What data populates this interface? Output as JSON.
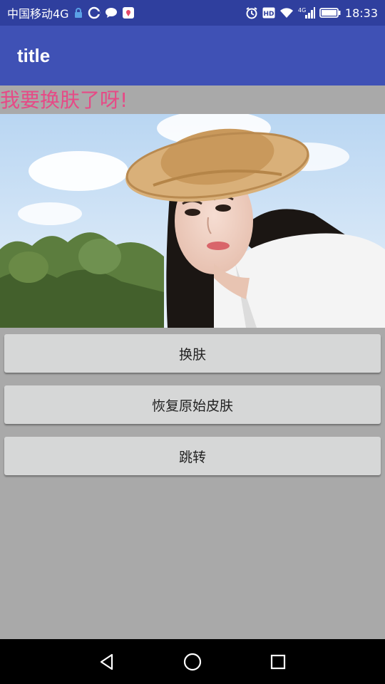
{
  "status_bar": {
    "carrier": "中国移动4G",
    "time": "18:33",
    "left_icons": [
      "lock-icon",
      "sync-icon",
      "chat-icon",
      "map-pin-icon"
    ],
    "right_icons": [
      "alarm-icon",
      "hd-icon",
      "wifi-icon",
      "signal-4g-icon",
      "battery-icon"
    ]
  },
  "app_bar": {
    "title": "title",
    "color": "#3f51b5"
  },
  "content": {
    "skin_text": "我要换肤了呀!",
    "skin_text_color": "#e64a86",
    "image_icon": "portrait-photo",
    "buttons": {
      "change_skin": "换肤",
      "restore_skin": "恢复原始皮肤",
      "jump": "跳转"
    }
  },
  "nav_bar": {
    "icons": [
      "back-triangle-icon",
      "home-circle-icon",
      "recent-square-icon"
    ]
  }
}
